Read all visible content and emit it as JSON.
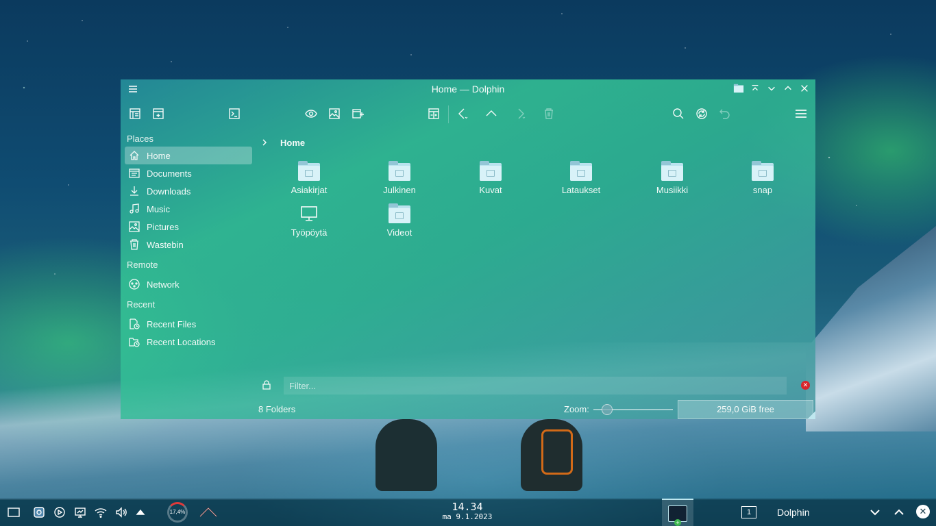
{
  "window": {
    "title": "Home — Dolphin"
  },
  "sidebar": {
    "sections": [
      {
        "title": "Places",
        "items": [
          {
            "label": "Home",
            "icon": "home-icon",
            "active": true
          },
          {
            "label": "Documents",
            "icon": "documents-icon"
          },
          {
            "label": "Downloads",
            "icon": "downloads-icon"
          },
          {
            "label": "Music",
            "icon": "music-icon"
          },
          {
            "label": "Pictures",
            "icon": "pictures-icon"
          },
          {
            "label": "Wastebin",
            "icon": "wastebin-icon"
          }
        ]
      },
      {
        "title": "Remote",
        "items": [
          {
            "label": "Network",
            "icon": "network-icon"
          }
        ]
      },
      {
        "title": "Recent",
        "items": [
          {
            "label": "Recent Files",
            "icon": "recent-files-icon"
          },
          {
            "label": "Recent Locations",
            "icon": "recent-locations-icon"
          }
        ]
      }
    ]
  },
  "breadcrumb": {
    "current": "Home"
  },
  "files": [
    {
      "name": "Asiakirjat",
      "icon": "folder-icon"
    },
    {
      "name": "Julkinen",
      "icon": "folder-icon"
    },
    {
      "name": "Kuvat",
      "icon": "folder-icon"
    },
    {
      "name": "Lataukset",
      "icon": "folder-icon"
    },
    {
      "name": "Musiikki",
      "icon": "folder-icon"
    },
    {
      "name": "snap",
      "icon": "folder-icon"
    },
    {
      "name": "Työpöytä",
      "icon": "desktop-icon"
    },
    {
      "name": "Videot",
      "icon": "folder-icon"
    }
  ],
  "filter": {
    "placeholder": "Filter..."
  },
  "status": {
    "count": "8 Folders",
    "zoom_label": "Zoom:",
    "free_space": "259,0 GiB free"
  },
  "panel": {
    "cpu": "17,4%",
    "time": "14.34",
    "date": "ma 9.1.2023",
    "desktop_number": "1",
    "active_window": "Dolphin"
  },
  "colors": {
    "accent": "#bfe7ef",
    "close_red": "#d8262b"
  }
}
